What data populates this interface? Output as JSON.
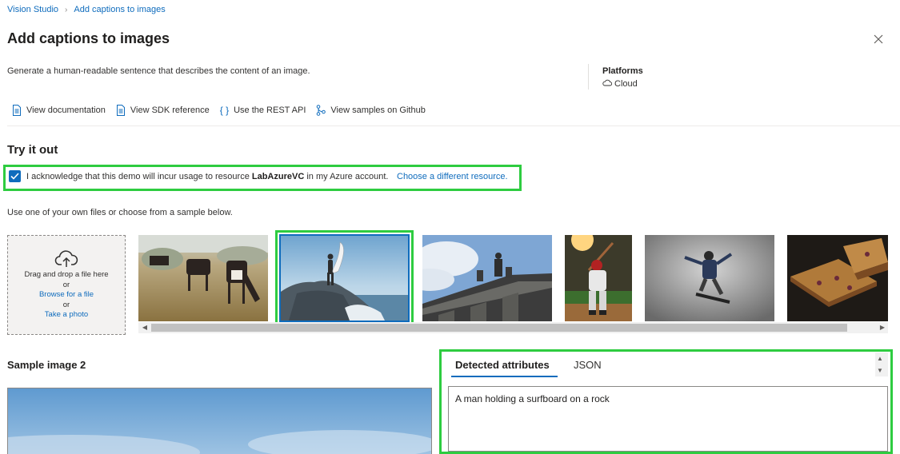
{
  "breadcrumb": {
    "root": "Vision Studio",
    "current": "Add captions to images"
  },
  "page": {
    "title": "Add captions to images",
    "description": "Generate a human-readable sentence that describes the content of an image."
  },
  "platforms": {
    "label": "Platforms",
    "value": "Cloud"
  },
  "links": {
    "documentation": "View documentation",
    "sdk": "View SDK reference",
    "rest": "Use the REST API",
    "github": "View samples on Github"
  },
  "try_it": {
    "title": "Try it out",
    "ack_prefix": "I acknowledge that this demo will incur usage to resource ",
    "ack_resource": "LabAzureVC",
    "ack_suffix": " in my Azure account.",
    "ack_link": "Choose a different resource.",
    "ack_checked": true,
    "use_text": "Use one of your own files or choose from a sample below."
  },
  "dropzone": {
    "line1": "Drag and drop a file here",
    "or1": "or",
    "browse": "Browse for a file",
    "or2": "or",
    "photo": "Take a photo"
  },
  "samples": [
    {
      "name": "cows-in-field",
      "selected": false
    },
    {
      "name": "surfer-on-rock",
      "selected": true
    },
    {
      "name": "building-statue",
      "selected": false
    },
    {
      "name": "baseball-batter",
      "selected": false
    },
    {
      "name": "skateboarder",
      "selected": false
    },
    {
      "name": "sandwich",
      "selected": false
    }
  ],
  "result": {
    "sample_title": "Sample image 2",
    "tab_attributes": "Detected attributes",
    "tab_json": "JSON",
    "caption": "A man holding a surfboard on a rock"
  },
  "colors": {
    "accent": "#0f6cbd",
    "highlight": "#2ecc40"
  }
}
